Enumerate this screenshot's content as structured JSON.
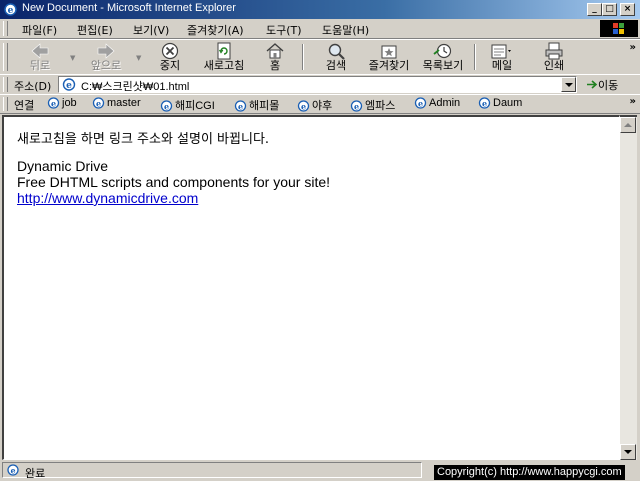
{
  "window": {
    "title": "New Document - Microsoft Internet Explorer",
    "minimize": "_",
    "maximize": "□",
    "close": "×"
  },
  "menu": [
    {
      "label": "파일(F)"
    },
    {
      "label": "편집(E)"
    },
    {
      "label": "보기(V)"
    },
    {
      "label": "즐겨찾기(A)"
    },
    {
      "label": "도구(T)"
    },
    {
      "label": "도움말(H)"
    }
  ],
  "toolbar": {
    "back": "뒤로",
    "forward": "앞으로",
    "stop": "중지",
    "refresh": "새로고침",
    "home": "홈",
    "search": "검색",
    "favorites": "즐겨찾기",
    "history": "목록보기",
    "mail": "메일",
    "print": "인쇄",
    "chevron": "»"
  },
  "address": {
    "label": "주소(D)",
    "value": "C:₩스크린샷₩01.html",
    "go": "이동"
  },
  "links": {
    "label": "연결",
    "items": [
      "job",
      "master",
      "해피CGI",
      "해피몰",
      "야후",
      "엠파스",
      "Admin",
      "Daum"
    ],
    "chevron": "»"
  },
  "content": {
    "line1": "새로고침을 하면 링크 주소와 설명이 바뀝니다.",
    "line2": "Dynamic Drive",
    "line3": "Free DHTML scripts and components for your site!",
    "link": "http://www.dynamicdrive.com"
  },
  "status": {
    "text": "완료",
    "copyright": "Copyright(c) http://www.happycgi.com"
  },
  "colors": {
    "titlebar_start": "#0a246a",
    "titlebar_end": "#a6caf0",
    "chrome": "#d4d0c8",
    "link": "#0000cc"
  }
}
